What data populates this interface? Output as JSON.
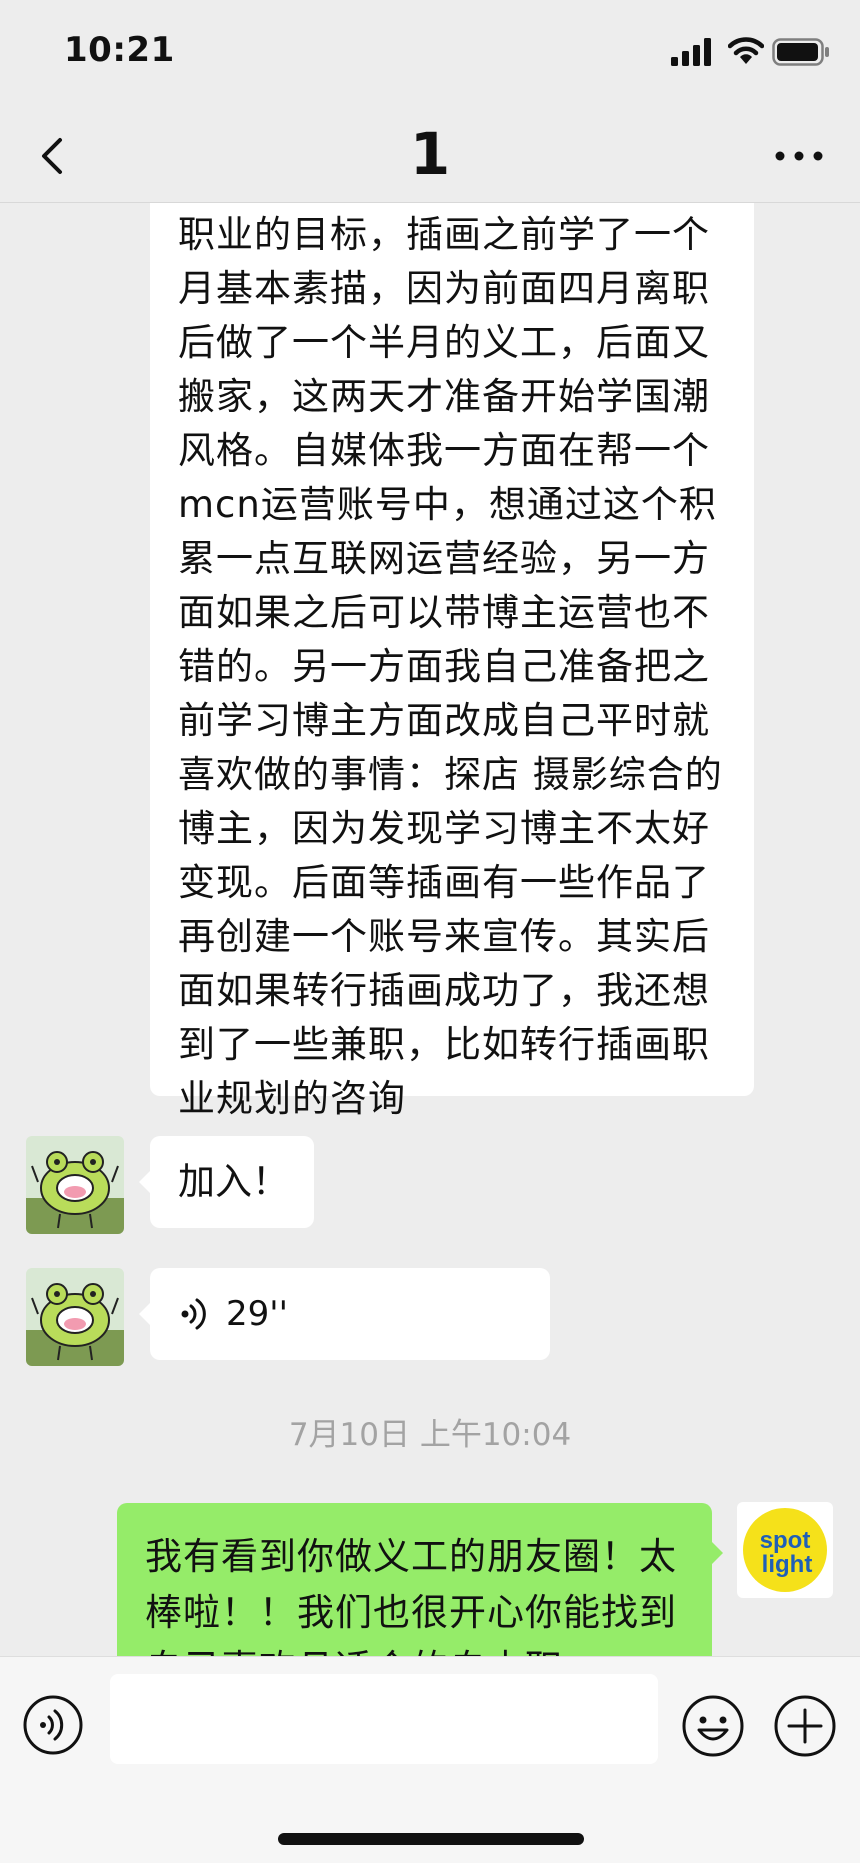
{
  "status_bar": {
    "time": "10:21",
    "icons": [
      "cellular-signal-icon",
      "wifi-icon",
      "battery-icon"
    ]
  },
  "nav": {
    "back_icon": "chevron-left-icon",
    "title": "1",
    "more_icon": "more-horizontal-icon"
  },
  "messages": {
    "incoming_long_text": "职业的目标，插画之前学了一个月基本素描，因为前面四月离职后做了一个半月的义工，后面又搬家，这两天才准备开始学国潮风格。自媒体我一方面在帮一个mcn运营账号中，想通过这个积累一点互联网运营经验，另一方面如果之后可以带博主运营也不错的。另一方面我自己准备把之前学习博主方面改成自己平时就喜欢做的事情：探店 摄影综合的博主，因为发现学习博主不太好变现。后面等插画有一些作品了再创建一个账号来宣传。其实后面如果转行插画成功了，我还想到了一些兼职，比如转行插画职业规划的咨询",
    "incoming_join": "加入！",
    "incoming_voice_duration": "29''",
    "timestamp": "7月10日 上午10:04",
    "outgoing_text": "我有看到你做义工的朋友圈！太棒啦！！我们也很开心你能找到自己喜欢且适合的自由职",
    "outgoing_avatar_lines": [
      "spot",
      "light"
    ]
  },
  "colors": {
    "background": "#ededed",
    "incoming_bubble": "#ffffff",
    "outgoing_bubble": "#95ec69",
    "spotlight_yellow": "#f5e11a",
    "spotlight_blue": "#1f5fb8",
    "frog_green": "#b9dc5a"
  },
  "input_bar": {
    "placeholder": "",
    "voice_icon": "voice-mode-icon",
    "emoji_icon": "emoji-icon",
    "plus_icon": "plus-icon"
  }
}
